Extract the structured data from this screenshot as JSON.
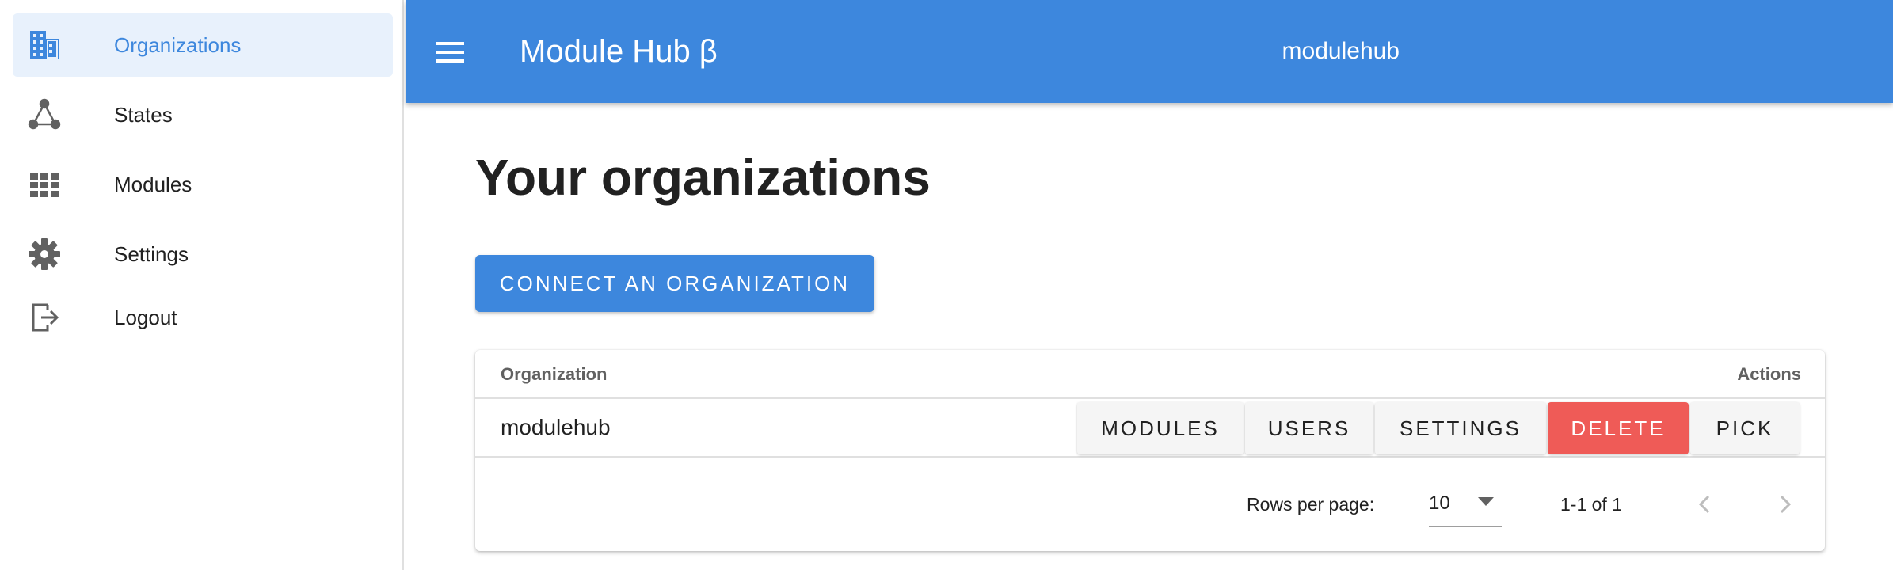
{
  "sidebar": {
    "items": [
      {
        "label": "Organizations",
        "icon": "building-icon",
        "active": true
      },
      {
        "label": "States",
        "icon": "triangle-nodes-icon",
        "active": false
      },
      {
        "label": "Modules",
        "icon": "grid-icon",
        "active": false
      },
      {
        "label": "Settings",
        "icon": "gear-icon",
        "active": false
      },
      {
        "label": "Logout",
        "icon": "logout-icon",
        "active": false
      }
    ]
  },
  "appbar": {
    "title": "Module Hub β",
    "organization": "modulehub"
  },
  "main": {
    "title": "Your organizations",
    "connect_button": "Connect an organization",
    "table": {
      "columns": [
        "Organization",
        "Actions"
      ],
      "rows": [
        {
          "name": "modulehub",
          "actions": [
            "Modules",
            "Users",
            "Settings",
            "Delete",
            "Pick"
          ]
        }
      ],
      "footer": {
        "rows_per_page_label": "Rows per page:",
        "rows_per_page": "10",
        "range": "1-1 of 1"
      }
    }
  },
  "colors": {
    "primary": "#3d87dd",
    "danger": "#ef5b57",
    "active_bg": "#e8f1fc"
  }
}
